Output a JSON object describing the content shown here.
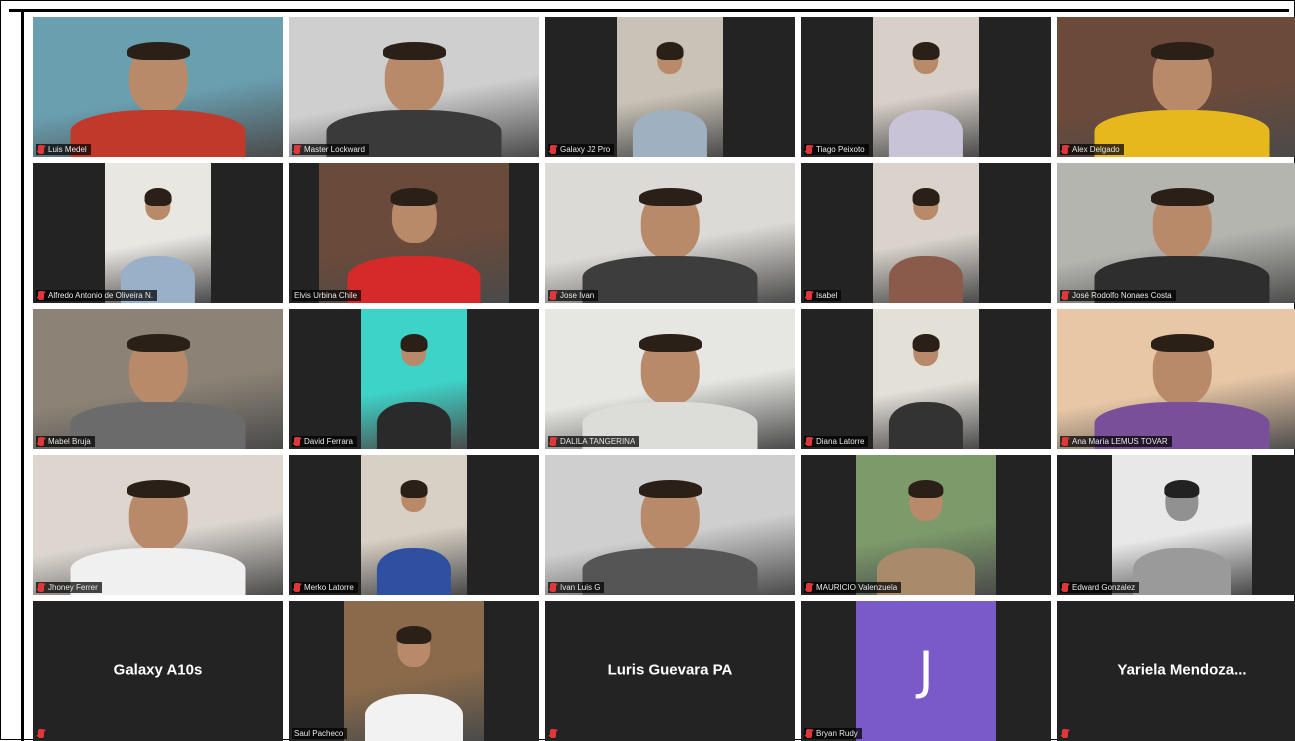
{
  "meeting": {
    "participants": [
      {
        "name": "Luis Medel",
        "type": "video",
        "muted": true,
        "bg": "#6a9fb0",
        "shirt": "#c0392b",
        "layout": "full"
      },
      {
        "name": "Master Lockward",
        "type": "video",
        "muted": true,
        "bg": "#cfcfcf",
        "shirt": "#3a3a3a",
        "layout": "full"
      },
      {
        "name": "Galaxy J2 Pro",
        "type": "video",
        "muted": true,
        "bg": "#c9c2b6",
        "shirt": "#9fb0c0",
        "layout": "center"
      },
      {
        "name": "Tiago Peixoto",
        "type": "video",
        "muted": true,
        "bg": "#d8d0c8",
        "shirt": "#c9c3d8",
        "layout": "center"
      },
      {
        "name": "Alex Delgado",
        "type": "video",
        "muted": true,
        "bg": "#6b4a3a",
        "shirt": "#e6b81e",
        "layout": "full"
      },
      {
        "name": "Alfredo Antonio de Oliveira N.",
        "type": "video",
        "muted": true,
        "bg": "#e9e7e2",
        "shirt": "#9ab0c8",
        "layout": "center"
      },
      {
        "name": "Elvis Urbina Chile",
        "type": "video",
        "muted": false,
        "bg": "#6a4a3a",
        "shirt": "#d62a2a",
        "layout": "center-wide"
      },
      {
        "name": "Jose Ivan",
        "type": "video",
        "muted": true,
        "bg": "#dcdad6",
        "shirt": "#3d3d3d",
        "layout": "full"
      },
      {
        "name": "Isabel",
        "type": "video",
        "muted": true,
        "bg": "#d9d3cb",
        "shirt": "#8a5a4a",
        "layout": "center"
      },
      {
        "name": "José Rodolfo Nonaes Costa",
        "type": "video",
        "muted": true,
        "bg": "#b5b5b0",
        "shirt": "#2e2e2e",
        "layout": "full"
      },
      {
        "name": "Mabel Bruja",
        "type": "video",
        "muted": true,
        "bg": "#8c8376",
        "shirt": "#6b6b6b",
        "layout": "full"
      },
      {
        "name": "David Ferrara",
        "type": "video",
        "muted": true,
        "bg": "#3ed3c8",
        "shirt": "#2a2a2a",
        "layout": "center"
      },
      {
        "name": "DALILA TANGERINA",
        "type": "video",
        "muted": true,
        "bg": "#e6e6e2",
        "shirt": "#dcdcd8",
        "layout": "full"
      },
      {
        "name": "Diana Latorre",
        "type": "video",
        "muted": true,
        "bg": "#e3e0d8",
        "shirt": "#333333",
        "layout": "center"
      },
      {
        "name": "Ana María LEMUS TOVAR",
        "type": "video",
        "muted": true,
        "bg": "#e8c7a6",
        "shirt": "#7a4f9a",
        "layout": "full"
      },
      {
        "name": "Jhoney Ferrer",
        "type": "video",
        "muted": true,
        "bg": "#dcd6cf",
        "shirt": "#f0f0f0",
        "layout": "full"
      },
      {
        "name": "Merko Latorre",
        "type": "video",
        "muted": true,
        "bg": "#d8d0c4",
        "shirt": "#2f4fa0",
        "layout": "center"
      },
      {
        "name": "Ivan Luis G",
        "type": "video",
        "muted": true,
        "bg": "#cfcfcf",
        "shirt": "#555555",
        "layout": "full"
      },
      {
        "name": "MAURICIO Valenzuela",
        "type": "video",
        "muted": true,
        "bg": "#7c9a6a",
        "shirt": "#a98a6a",
        "layout": "center-mid"
      },
      {
        "name": "Edward Gonzalez",
        "type": "video",
        "muted": true,
        "bg": "#e8e8e8",
        "shirt": "#9a9a9a",
        "layout": "center-mid",
        "grayscale": true
      },
      {
        "name": "Galaxy A10s",
        "type": "name",
        "muted": true
      },
      {
        "name": "Saul Pacheco",
        "type": "video",
        "muted": false,
        "bg": "#8a6a4a",
        "shirt": "#f2f2f2",
        "layout": "center-mid"
      },
      {
        "name": "Luris Guevara PA",
        "type": "name",
        "muted": true
      },
      {
        "name": "Bryan Rudy",
        "type": "avatar",
        "initial": "J",
        "muted": true,
        "avatar_color": "#7a5ac8"
      },
      {
        "name": "Yariela  Mendoza...",
        "type": "name",
        "muted": true
      }
    ]
  }
}
